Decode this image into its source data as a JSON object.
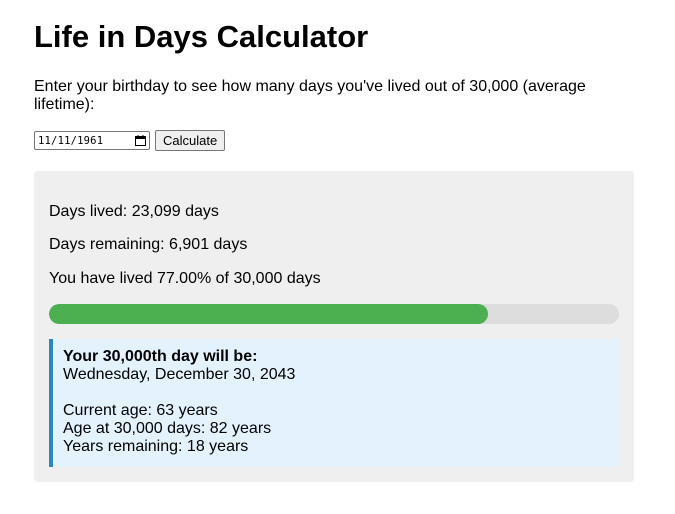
{
  "page": {
    "title": "Life in Days Calculator",
    "intro": "Enter your birthday to see how many days you've lived out of 30,000 (average lifetime):"
  },
  "form": {
    "birthday_value": "11/11/1961",
    "calculate_label": "Calculate"
  },
  "results": {
    "days_lived": "Days lived: 23,099 days",
    "days_remaining": "Days remaining: 6,901 days",
    "percent_lived": "You have lived 77.00% of 30,000 days",
    "progress_fraction": 0.77
  },
  "milestone": {
    "heading": "Your 30,000th day will be:",
    "date": "Wednesday, December 30, 2043",
    "current_age": "Current age: 63 years",
    "age_at_milestone": "Age at 30,000 days: 82 years",
    "years_remaining": "Years remaining: 18 years"
  },
  "colors": {
    "progress_fill": "#4caf50",
    "progress_track": "#dddddd",
    "panel_background": "#efefef",
    "info_background": "#e3f2fd",
    "info_accent": "#2b86c5"
  },
  "icons": {
    "date_picker": "calendar-icon"
  }
}
